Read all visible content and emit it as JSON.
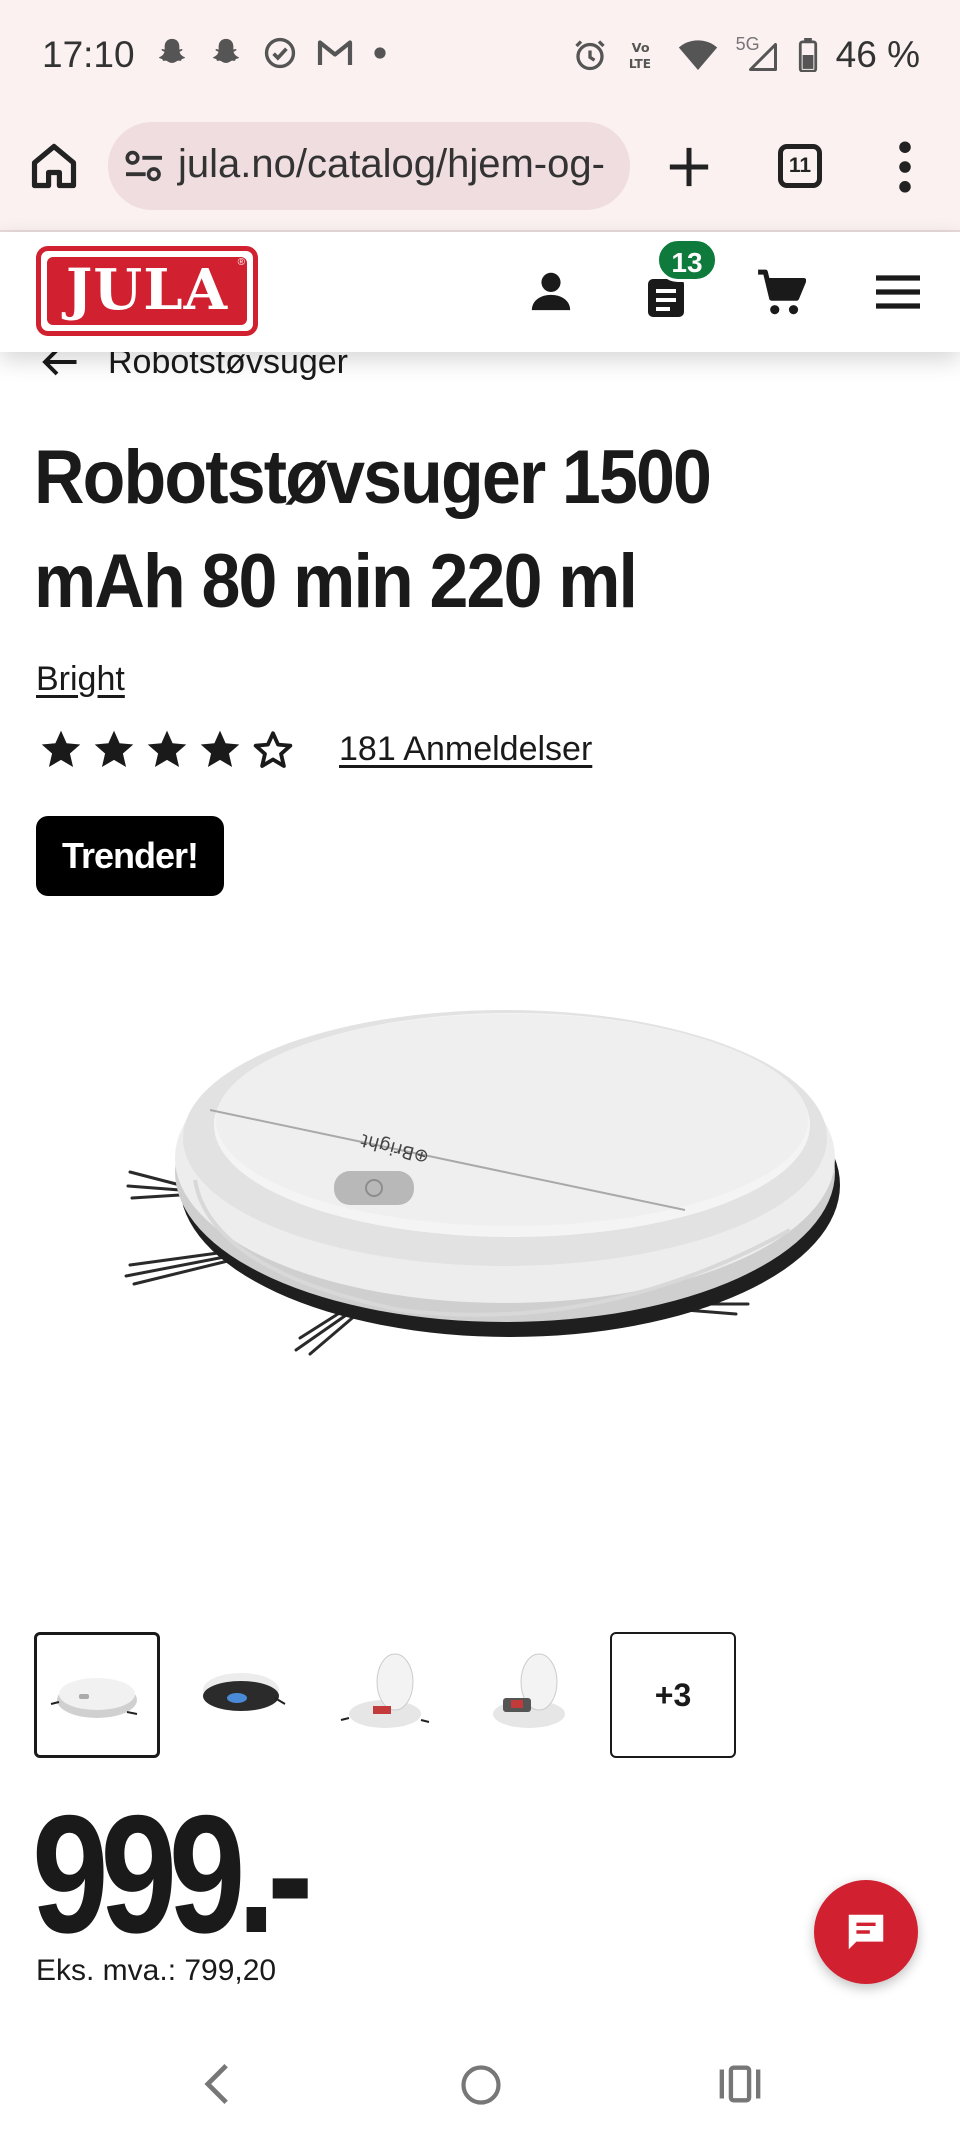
{
  "status_bar": {
    "time": "17:10",
    "battery_text": "46 %",
    "network_labels": [
      "Vo LTE",
      "5G"
    ],
    "icons": [
      "snapchat-icon",
      "snapchat-icon",
      "check-circle-icon",
      "gmail-icon",
      "dot-icon",
      "alarm-icon",
      "volte-icon",
      "wifi-icon",
      "signal-icon",
      "battery-icon"
    ]
  },
  "browser": {
    "url": "jula.no/catalog/hjem-og-",
    "tab_count": "11"
  },
  "header": {
    "logo_text": "JULA",
    "logo_reg": "®",
    "list_badge": "13",
    "brand_color": "#d1202f",
    "badge_color": "#0e7a3b"
  },
  "breadcrumb": {
    "label": "Robotstøvsuger"
  },
  "product": {
    "title": "Robotstøvsuger 1500 mAh 80 min 220 ml",
    "brand": "Bright",
    "rating": 4.5,
    "reviews": "181 Anmeldelser",
    "badge": "Trender!",
    "image_brand_print": "⊕Bright",
    "more_images": "+3",
    "price": "999.-",
    "ex_vat": "Eks. mva.: 799,20"
  }
}
